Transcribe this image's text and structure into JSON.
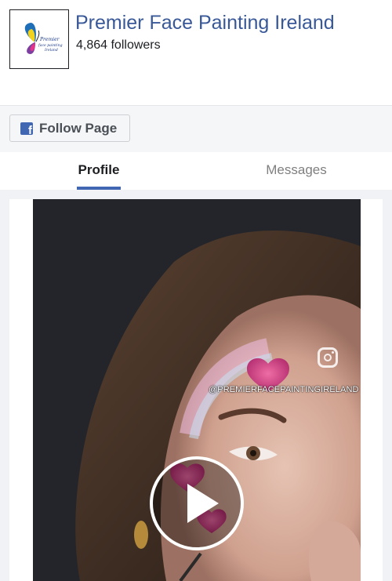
{
  "page": {
    "name": "Premier Face Painting Ireland",
    "followers": "4,864 followers",
    "logo_text": [
      "Premier",
      "face painting",
      "Ireland"
    ]
  },
  "actions": {
    "follow_label": "Follow Page"
  },
  "tabs": [
    {
      "label": "Profile",
      "active": true
    },
    {
      "label": "Messages",
      "active": false
    }
  ],
  "video": {
    "handle": "@PREMIERFACEPAINTINGIRELAND",
    "icons": [
      "instagram-icon",
      "play-icon"
    ]
  },
  "colors": {
    "brand_blue": "#385898",
    "tab_underline": "#4267b2",
    "facebook_blue": "#4267b2"
  }
}
